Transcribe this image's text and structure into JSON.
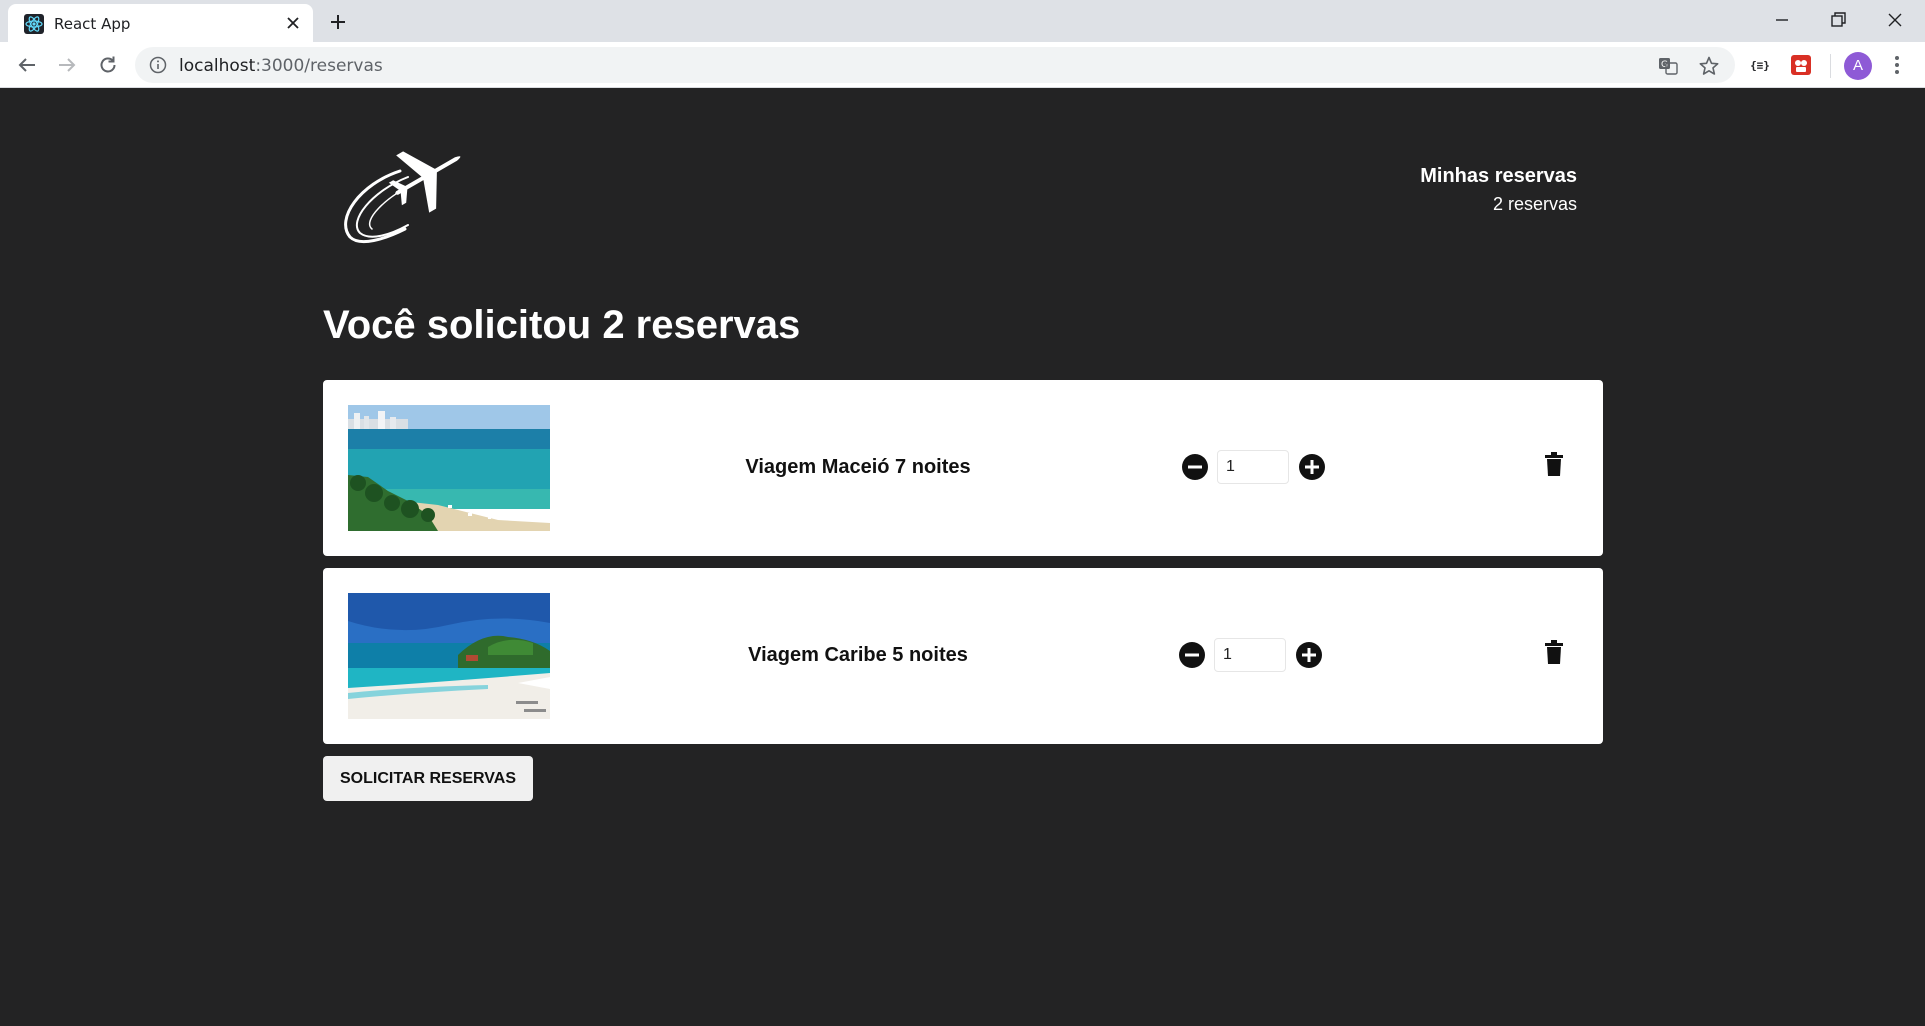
{
  "browser": {
    "tab_title": "React App",
    "url_host": "localhost",
    "url_path": ":3000/reservas",
    "profile_initial": "A",
    "profile_color": "#8e5ad6"
  },
  "header": {
    "cart_title": "Minhas reservas",
    "cart_count": "2 reservas"
  },
  "main": {
    "title": "Você solicitou 2 reservas",
    "reservations": [
      {
        "name": "Viagem Maceió 7 noites",
        "quantity": "1",
        "image": "maceio-beach-photo"
      },
      {
        "name": "Viagem Caribe 5 noites",
        "quantity": "1",
        "image": "caribe-beach-photo"
      }
    ],
    "submit_label": "SOLICITAR RESERVAS"
  },
  "colors": {
    "page_bg": "#232324",
    "card_bg": "#ffffff",
    "button_bg": "#f0f0f0"
  }
}
